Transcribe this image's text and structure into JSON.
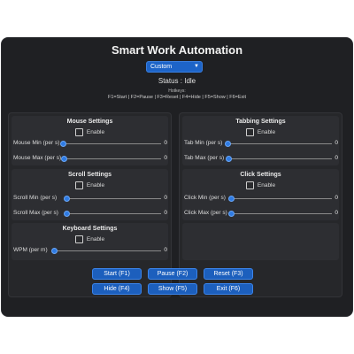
{
  "app": {
    "title": "Smart Work Automation",
    "mode": "Custom",
    "status": "Status : Idle",
    "hotkeys_title": "Hotkeys:",
    "hotkeys_line": "F1=Start | F2=Pause | F3=Reset | F4=Hide | F5=Show | F6=Exit"
  },
  "mouse": {
    "title": "Mouse Settings",
    "enable_label": "Enable",
    "enabled": false,
    "min_label": "Mouse Min (per s)",
    "min_value": "0",
    "max_label": "Mouse Max (per s)",
    "max_value": "0"
  },
  "scroll": {
    "title": "Scroll Settings",
    "enable_label": "Enable",
    "enabled": false,
    "min_label": "Scroll Min (per s)",
    "min_value": "0",
    "max_label": "Scroll Max (per s)",
    "max_value": "0"
  },
  "keyboard": {
    "title": "Keyboard Settings",
    "enable_label": "Enable",
    "enabled": false,
    "wpm_label": "WPM (per m)",
    "wpm_value": "0"
  },
  "tabbing": {
    "title": "Tabbing Settings",
    "enable_label": "Enable",
    "enabled": false,
    "min_label": "Tab Min (per s)",
    "min_value": "0",
    "max_label": "Tab Max (per s)",
    "max_value": "0"
  },
  "click": {
    "title": "Click Settings",
    "enable_label": "Enable",
    "enabled": false,
    "min_label": "Click Min (per s)",
    "min_value": "0",
    "max_label": "Click Max (per s)",
    "max_value": "0"
  },
  "buttons": {
    "start": "Start (F1)",
    "pause": "Pause (F2)",
    "reset": "Reset (F3)",
    "hide": "Hide (F4)",
    "show": "Show (F5)",
    "exit": "Exit (F6)"
  },
  "colors": {
    "window_bg": "#1f2023",
    "accent": "#1c5fbd",
    "slider_knob": "#2f7be3"
  }
}
